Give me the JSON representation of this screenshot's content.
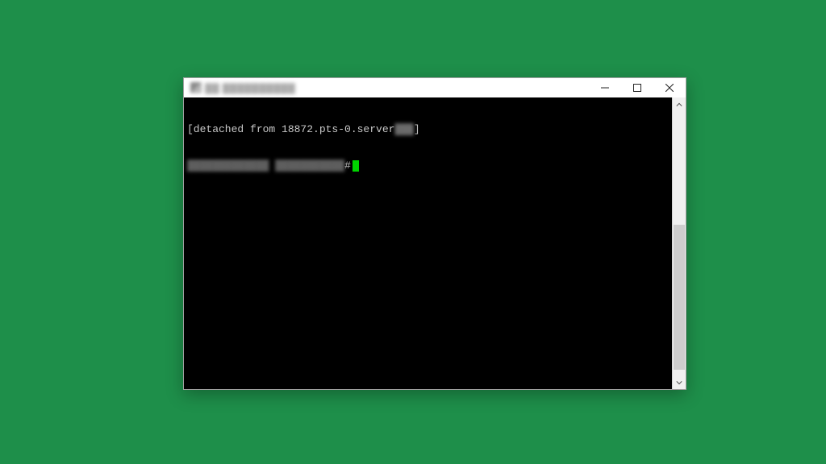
{
  "window": {
    "title_obscured": "▓▓ ▓▓▓▓▓▓▓▓▓▓",
    "icon_name": "terminal-app-icon"
  },
  "terminal": {
    "line1_open": "[detached from 18872.pts-0.server",
    "line1_blur": "▓▓▓",
    "line1_close": "]",
    "line2_blur1": "▓▓▓▓▓▓▓▓▓▓▓▓▓",
    "line2_blur2": "▓▓▓▓▓▓▓▓▓▓▓",
    "line2_prompt": "#",
    "cursor_color": "#00d400"
  },
  "colors": {
    "desktop": "#1e8f4a",
    "terminal_bg": "#000000",
    "terminal_fg": "#c8c8c8"
  }
}
